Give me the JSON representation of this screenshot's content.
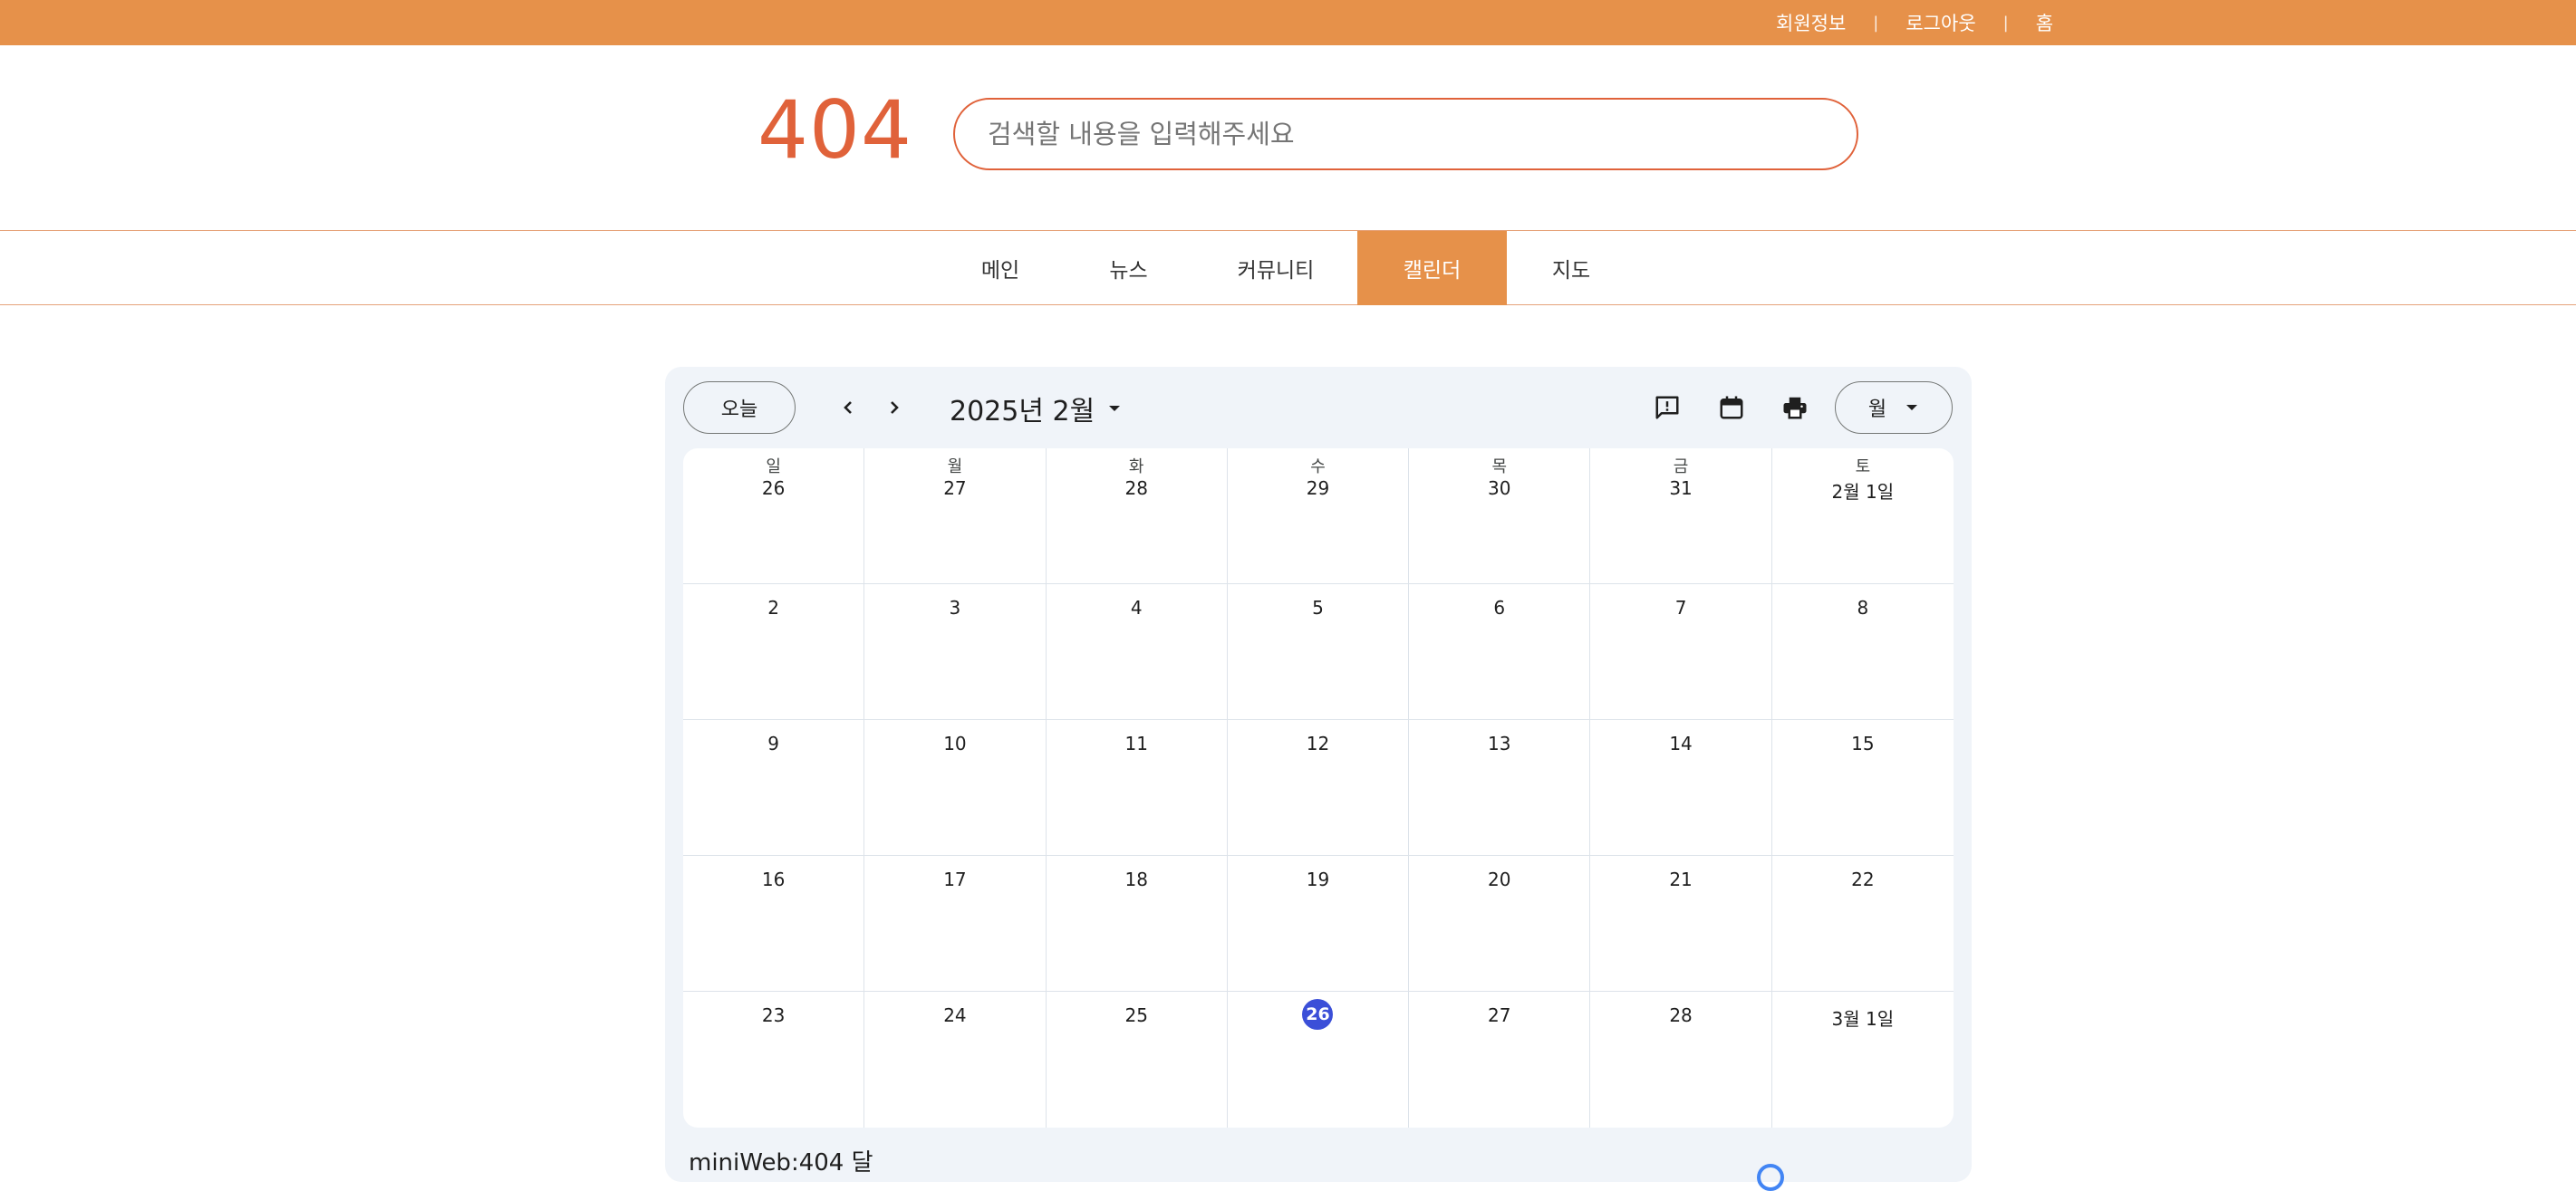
{
  "topbar": {
    "links": [
      "회원정보",
      "로그아웃",
      "홈"
    ],
    "separator": "|"
  },
  "header": {
    "logo": "404",
    "search_placeholder": "검색할 내용을 입력해주세요"
  },
  "nav": {
    "items": [
      "메인",
      "뉴스",
      "커뮤니티",
      "캘린더",
      "지도"
    ],
    "active": "캘린더"
  },
  "calendar": {
    "today_label": "오늘",
    "month_title": "2025년 2월",
    "view_label": "월",
    "weekdays": [
      "일",
      "월",
      "화",
      "수",
      "목",
      "금",
      "토"
    ],
    "weeks": [
      [
        "26",
        "27",
        "28",
        "29",
        "30",
        "31",
        "2월 1일"
      ],
      [
        "2",
        "3",
        "4",
        "5",
        "6",
        "7",
        "8"
      ],
      [
        "9",
        "10",
        "11",
        "12",
        "13",
        "14",
        "15"
      ],
      [
        "16",
        "17",
        "18",
        "19",
        "20",
        "21",
        "22"
      ],
      [
        "23",
        "24",
        "25",
        "26",
        "27",
        "28",
        "3월 1일"
      ]
    ],
    "today": {
      "week": 4,
      "day": 3
    },
    "footer_title": "miniWeb:404 달",
    "colors": {
      "accent": "#e6914a",
      "logo": "#e0623a",
      "today": "#3b4fd8",
      "panel": "#f0f4f9"
    }
  }
}
